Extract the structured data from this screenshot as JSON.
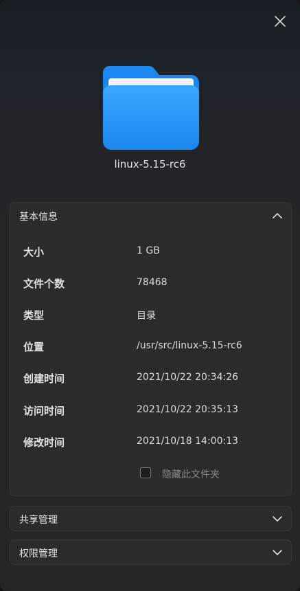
{
  "dialog": {
    "file_name": "linux-5.15-rc6",
    "close_icon": "close-icon",
    "folder_icon": "folder-icon",
    "accent_color": "#1f8ff0"
  },
  "basic_info": {
    "title": "基本信息",
    "expanded": true,
    "rows": [
      {
        "key": "大小",
        "value": "1 GB"
      },
      {
        "key": "文件个数",
        "value": "78468"
      },
      {
        "key": "类型",
        "value": "目录"
      },
      {
        "key": "位置",
        "value": "/usr/src/linux-5.15-rc6"
      },
      {
        "key": "创建时间",
        "value": "2021/10/22 20:34:26"
      },
      {
        "key": "访问时间",
        "value": "2021/10/22 20:35:13"
      },
      {
        "key": "修改时间",
        "value": "2021/10/18 14:00:13"
      }
    ],
    "hide_folder_label": "隐藏此文件夹",
    "hide_folder_checked": false
  },
  "share": {
    "title": "共享管理",
    "expanded": false
  },
  "permissions": {
    "title": "权限管理",
    "expanded": false
  }
}
